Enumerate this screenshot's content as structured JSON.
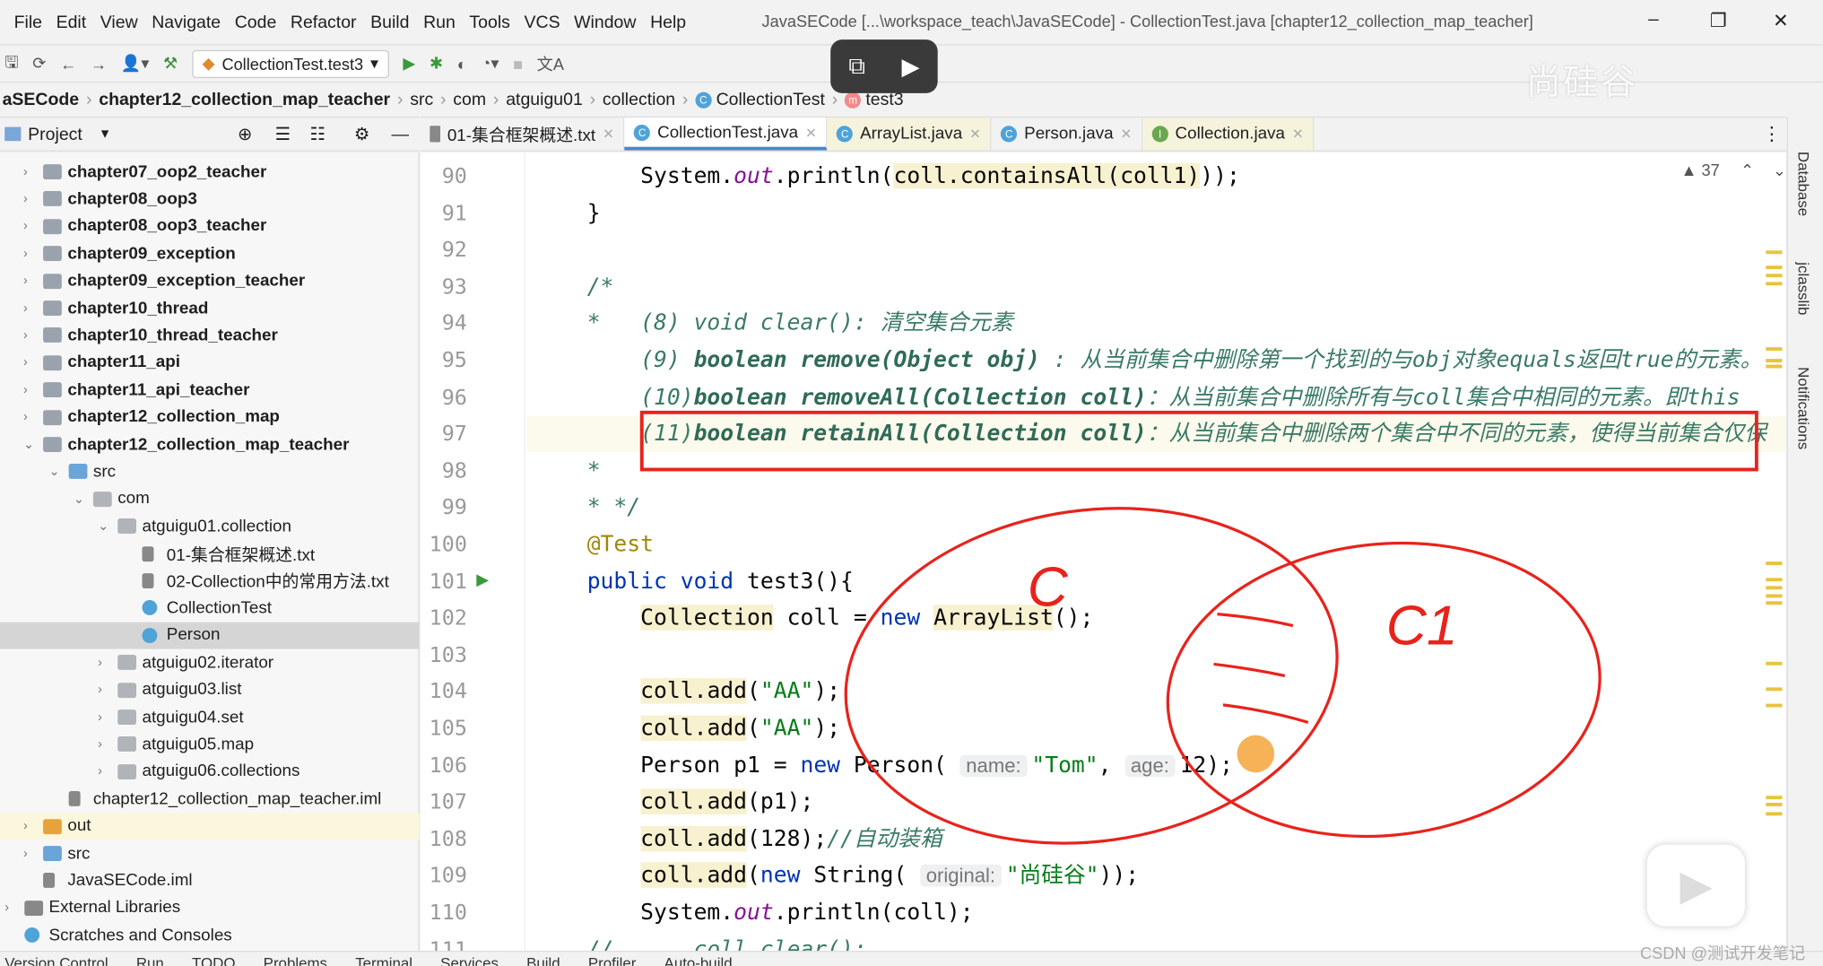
{
  "menu": [
    "File",
    "Edit",
    "View",
    "Navigate",
    "Code",
    "Refactor",
    "Build",
    "Run",
    "Tools",
    "VCS",
    "Window",
    "Help"
  ],
  "window_title": "JavaSECode [...\\workspace_teach\\JavaSECode] - CollectionTest.java [chapter12_collection_map_teacher]",
  "window_controls": {
    "minimize": "–",
    "restore": "❐",
    "close": "✕"
  },
  "toolbar": {
    "run_config": "CollectionTest.test3"
  },
  "breadcrumb": [
    "aSECode",
    "chapter12_collection_map_teacher",
    "src",
    "com",
    "atguigu01",
    "collection",
    "CollectionTest",
    "test3"
  ],
  "project": {
    "label": "Project",
    "items": [
      {
        "label": "chapter07_oop2_teacher",
        "depth": 1,
        "kind": "module",
        "arrow": "›"
      },
      {
        "label": "chapter08_oop3",
        "depth": 1,
        "kind": "module",
        "arrow": "›"
      },
      {
        "label": "chapter08_oop3_teacher",
        "depth": 1,
        "kind": "module",
        "arrow": "›"
      },
      {
        "label": "chapter09_exception",
        "depth": 1,
        "kind": "module",
        "arrow": "›"
      },
      {
        "label": "chapter09_exception_teacher",
        "depth": 1,
        "kind": "module",
        "arrow": "›"
      },
      {
        "label": "chapter10_thread",
        "depth": 1,
        "kind": "module",
        "arrow": "›"
      },
      {
        "label": "chapter10_thread_teacher",
        "depth": 1,
        "kind": "module",
        "arrow": "›"
      },
      {
        "label": "chapter11_api",
        "depth": 1,
        "kind": "module",
        "arrow": "›"
      },
      {
        "label": "chapter11_api_teacher",
        "depth": 1,
        "kind": "module",
        "arrow": "›"
      },
      {
        "label": "chapter12_collection_map",
        "depth": 1,
        "kind": "module",
        "arrow": "›"
      },
      {
        "label": "chapter12_collection_map_teacher",
        "depth": 1,
        "kind": "module",
        "arrow": "⌄"
      },
      {
        "label": "src",
        "depth": 2,
        "kind": "src",
        "arrow": "⌄"
      },
      {
        "label": "com",
        "depth": 3,
        "kind": "pkg",
        "arrow": "⌄"
      },
      {
        "label": "atguigu01.collection",
        "depth": 4,
        "kind": "pkg",
        "arrow": "⌄"
      },
      {
        "label": "01-集合框架概述.txt",
        "depth": 5,
        "kind": "txt"
      },
      {
        "label": "02-Collection中的常用方法.txt",
        "depth": 5,
        "kind": "txt"
      },
      {
        "label": "CollectionTest",
        "depth": 5,
        "kind": "class"
      },
      {
        "label": "Person",
        "depth": 5,
        "kind": "class",
        "selected": true
      },
      {
        "label": "atguigu02.iterator",
        "depth": 4,
        "kind": "pkg",
        "arrow": "›"
      },
      {
        "label": "atguigu03.list",
        "depth": 4,
        "kind": "pkg",
        "arrow": "›"
      },
      {
        "label": "atguigu04.set",
        "depth": 4,
        "kind": "pkg",
        "arrow": "›"
      },
      {
        "label": "atguigu05.map",
        "depth": 4,
        "kind": "pkg",
        "arrow": "›"
      },
      {
        "label": "atguigu06.collections",
        "depth": 4,
        "kind": "pkg",
        "arrow": "›"
      },
      {
        "label": "chapter12_collection_map_teacher.iml",
        "depth": 2,
        "kind": "iml"
      },
      {
        "label": "out",
        "depth": 1,
        "kind": "out",
        "arrow": "›",
        "excluded": true
      },
      {
        "label": "src",
        "depth": 1,
        "kind": "src",
        "arrow": "›"
      },
      {
        "label": "JavaSECode.iml",
        "depth": 1,
        "kind": "iml"
      },
      {
        "label": "External Libraries",
        "depth": 0,
        "kind": "lib",
        "arrow": "›"
      },
      {
        "label": "Scratches and Consoles",
        "depth": 0,
        "kind": "scratch"
      }
    ]
  },
  "tabs": [
    {
      "label": "01-集合框架概述.txt",
      "icon": "txt"
    },
    {
      "label": "CollectionTest.java",
      "icon": "class",
      "active": true
    },
    {
      "label": "ArrayList.java",
      "icon": "class",
      "tint": true
    },
    {
      "label": "Person.java",
      "icon": "class"
    },
    {
      "label": "Collection.java",
      "icon": "interface",
      "tint": true
    }
  ],
  "editor": {
    "warnings": "▲ 37",
    "current_line": 97,
    "lines": [
      {
        "n": "90",
        "s": [
          [
            "p",
            "    System."
          ],
          [
            "fld",
            "out"
          ],
          [
            "p",
            ".println("
          ],
          [
            "hl",
            "coll.containsAll(coll1)"
          ],
          [
            "p",
            "));"
          ]
        ]
      },
      {
        "n": "91",
        "s": [
          [
            "p",
            "}"
          ]
        ]
      },
      {
        "n": "92",
        "s": []
      },
      {
        "n": "93",
        "s": [
          [
            "cm",
            "/*"
          ]
        ]
      },
      {
        "n": "94",
        "s": [
          [
            "cm",
            "*   (8) void clear(): 清空集合元素"
          ]
        ]
      },
      {
        "n": "95",
        "s": [
          [
            "cm",
            "    (9) "
          ],
          [
            "cmb",
            "boolean remove(Object obj)"
          ],
          [
            "cm",
            " : 从当前集合中删除第一个找到的与obj对象equals返回true的元素。"
          ]
        ]
      },
      {
        "n": "96",
        "s": [
          [
            "cm",
            "    (10)"
          ],
          [
            "cmb",
            "boolean removeAll(Collection coll)"
          ],
          [
            "cm",
            "：从当前集合中删除所有与coll集合中相同的元素。即this"
          ]
        ]
      },
      {
        "n": "97",
        "s": [
          [
            "cm",
            "    (11)"
          ],
          [
            "cmb",
            "boolean retainAll(Collection coll)"
          ],
          [
            "cm",
            "：从当前集合中删除两个集合中不同的元素，使得当前集合仅保"
          ]
        ]
      },
      {
        "n": "98",
        "s": [
          [
            "cm",
            "*"
          ]
        ]
      },
      {
        "n": "99",
        "s": [
          [
            "cm",
            "* */"
          ]
        ]
      },
      {
        "n": "100",
        "s": [
          [
            "ann",
            "@Test"
          ]
        ]
      },
      {
        "n": "101",
        "s": [
          [
            "kw",
            "public void "
          ],
          [
            "p",
            "test3(){"
          ]
        ]
      },
      {
        "n": "102",
        "s": [
          [
            "p",
            "    "
          ],
          [
            "hl",
            "Collection"
          ],
          [
            "p",
            " coll = "
          ],
          [
            "kw",
            "new "
          ],
          [
            "hl",
            "ArrayList"
          ],
          [
            "p",
            "();"
          ]
        ]
      },
      {
        "n": "103",
        "s": []
      },
      {
        "n": "104",
        "s": [
          [
            "p",
            "    "
          ],
          [
            "hl",
            "coll.add"
          ],
          [
            "p",
            "("
          ],
          [
            "str",
            "\"AA\""
          ],
          [
            "p",
            ");"
          ]
        ]
      },
      {
        "n": "105",
        "s": [
          [
            "p",
            "    "
          ],
          [
            "hl",
            "coll.add"
          ],
          [
            "p",
            "("
          ],
          [
            "str",
            "\"AA\""
          ],
          [
            "p",
            ");"
          ]
        ]
      },
      {
        "n": "106",
        "s": [
          [
            "p",
            "    Person p1 = "
          ],
          [
            "kw",
            "new "
          ],
          [
            "p",
            "Person( "
          ],
          [
            "hint",
            "name:"
          ],
          [
            "str",
            "\"Tom\""
          ],
          [
            "p",
            ", "
          ],
          [
            "hint",
            "age:"
          ],
          [
            "p",
            "12);"
          ]
        ]
      },
      {
        "n": "107",
        "s": [
          [
            "p",
            "    "
          ],
          [
            "hl",
            "coll.add"
          ],
          [
            "p",
            "(p1);"
          ]
        ]
      },
      {
        "n": "108",
        "s": [
          [
            "p",
            "    "
          ],
          [
            "hl",
            "coll.add"
          ],
          [
            "p",
            "(128);"
          ],
          [
            "cm",
            "//自动装箱"
          ]
        ]
      },
      {
        "n": "109",
        "s": [
          [
            "p",
            "    "
          ],
          [
            "hl",
            "coll.add"
          ],
          [
            "p",
            "("
          ],
          [
            "kw",
            "new "
          ],
          [
            "p",
            "String( "
          ],
          [
            "hint",
            "original:"
          ],
          [
            "str",
            "\"尚硅谷\""
          ],
          [
            "p",
            "));"
          ]
        ]
      },
      {
        "n": "110",
        "s": [
          [
            "p",
            "    System."
          ],
          [
            "fld",
            "out"
          ],
          [
            "p",
            ".println(coll);"
          ]
        ]
      },
      {
        "n": "111",
        "s": [
          [
            "cm",
            "//      coll.clear();"
          ]
        ]
      }
    ]
  },
  "annotations": {
    "left_label": "C",
    "right_label": "C1",
    "stroke": "#e8231c"
  },
  "right_tools": [
    "Database",
    "jclasslib",
    "Notifications"
  ],
  "status_tools": [
    "Version Control",
    "Run",
    "TODO",
    "Problems",
    "Terminal",
    "Services",
    "Build",
    "Profiler",
    "Auto-build"
  ],
  "watermark": "尚硅谷",
  "csdn": "CSDN @测试开发笔记",
  "colors": {
    "accent": "#4a88c7",
    "annotation": "#e8231c",
    "selection": "#d5d5d5"
  }
}
